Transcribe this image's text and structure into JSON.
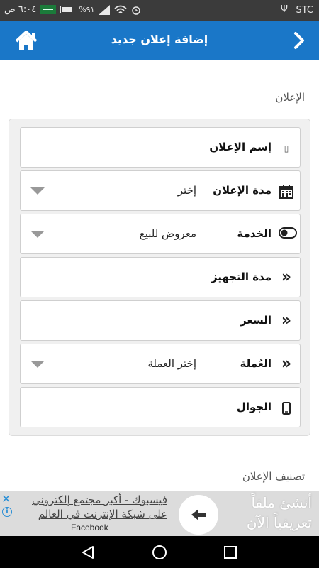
{
  "status_bar": {
    "carrier": "STC",
    "time": "٦:٠٤ ص",
    "battery": "%٩١"
  },
  "header": {
    "title": "إضافة إعلان جديد"
  },
  "sections": {
    "ad_label": "الإعلان",
    "classification_label": "تصنيف الإعلان"
  },
  "form": {
    "ad_name_label": "إسم الإعلان",
    "duration_label": "مدة الإعلان",
    "duration_value": "إختر",
    "service_label": "الخدمة",
    "service_value": "معروض للبيع",
    "prep_label": "مدة التجهيز",
    "price_label": "السعر",
    "currency_label": "العُملة",
    "currency_value": "إختر العملة",
    "mobile_label": "الجوال"
  },
  "ad_banner": {
    "logo_text": "أنشئ ملفاً تعريفياً الآن",
    "body_text": "فيسبوك - أكبر مجتمع إلكتروني على شبكة الإنترنت في العالم",
    "sub_text": "Facebook",
    "close": "✕",
    "info": "i"
  },
  "icons": {
    "back": "chevron-right-icon",
    "home": "home-icon",
    "calendar": "calendar-icon",
    "toggle": "toggle-icon",
    "chevrons": "double-chevron-right-icon",
    "mobile": "mobile-phone-icon"
  },
  "colors": {
    "header": "#1a77c8",
    "status_bar": "#3b3b3b",
    "panel": "#f0f0f0"
  }
}
